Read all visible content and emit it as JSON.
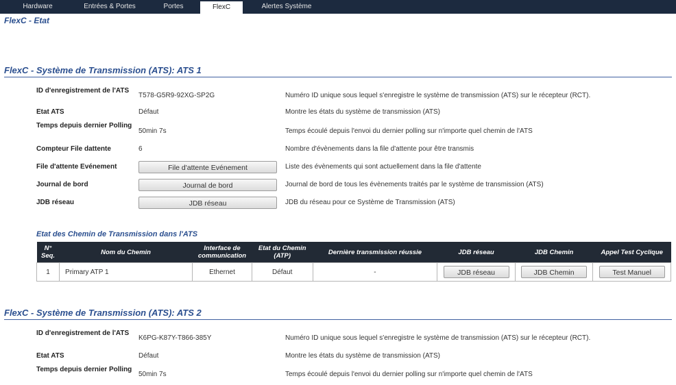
{
  "tabs": [
    {
      "label": "Hardware"
    },
    {
      "label": "Entrées & Portes"
    },
    {
      "label": "Portes"
    },
    {
      "label": "FlexC",
      "active": true
    },
    {
      "label": "Alertes Système"
    }
  ],
  "page_title": "FlexC - Etat",
  "ats1": {
    "title": "FlexC - Système de Transmission (ATS): ATS 1",
    "rows": [
      {
        "label": "ID d'enregistrement de l'ATS",
        "value": "T578-G5R9-92XG-SP2G",
        "desc": "Numéro ID unique sous lequel s'enregistre le système de transmission (ATS) sur le récepteur (RCT)."
      },
      {
        "label": "Etat ATS",
        "value": "Défaut",
        "desc": "Montre les états du système de transmission (ATS)"
      },
      {
        "label": "Temps depuis dernier Polling",
        "value": "50min 7s",
        "desc": "Temps écoulé depuis l'envoi du dernier polling sur n'importe quel chemin de l'ATS"
      },
      {
        "label": "Compteur File dattente",
        "value": "6",
        "desc": "Nombre d'évènements dans la file d'attente pour être transmis"
      },
      {
        "label": "File d'attente Evénement",
        "button": "File d'attente Evénement",
        "desc": "Liste des évènements qui sont actuellement dans la file d'attente"
      },
      {
        "label": "Journal de bord",
        "button": "Journal de bord",
        "desc": "Journal de bord de tous les évènements traités par le système de transmission (ATS)"
      },
      {
        "label": "JDB réseau",
        "button": "JDB réseau",
        "desc": "JDB du réseau pour ce Système de Transmission (ATS)"
      }
    ],
    "paths": {
      "title": "Etat des Chemin de Transmission dans l'ATS",
      "headers": [
        "N° Seq.",
        "Nom du Chemin",
        "Interface de communication",
        "Etat du Chemin (ATP)",
        "Dernière transmission réussie",
        "JDB réseau",
        "JDB Chemin",
        "Appel Test Cyclique"
      ],
      "rows": [
        {
          "seq": "1",
          "name": "Primary ATP 1",
          "interface": "Ethernet",
          "state": "Défaut",
          "last": "-",
          "btn_net": "JDB réseau",
          "btn_path": "JDB Chemin",
          "btn_test": "Test Manuel"
        }
      ]
    }
  },
  "ats2": {
    "title": "FlexC - Système de Transmission (ATS): ATS 2",
    "rows": [
      {
        "label": "ID d'enregistrement de l'ATS",
        "value": "K6PG-K87Y-T866-385Y",
        "desc": "Numéro ID unique sous lequel s'enregistre le système de transmission (ATS) sur le récepteur (RCT)."
      },
      {
        "label": "Etat ATS",
        "value": "Défaut",
        "desc": "Montre les états du système de transmission (ATS)"
      },
      {
        "label": "Temps depuis dernier Polling",
        "value": "50min 7s",
        "desc": "Temps écoulé depuis l'envoi du dernier polling sur n'importe quel chemin de l'ATS"
      }
    ]
  }
}
